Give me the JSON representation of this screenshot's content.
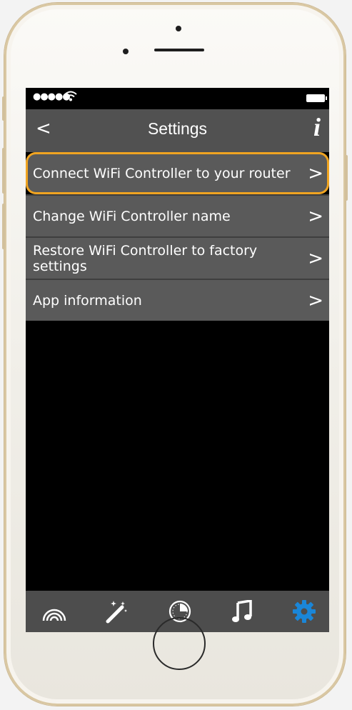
{
  "status_bar": {
    "signal": "●●●●●",
    "wifi_icon": "wifi-icon",
    "battery_icon": "battery-icon"
  },
  "header": {
    "back_icon": "<",
    "title": "Settings",
    "info_icon": "i"
  },
  "menu": {
    "items": [
      {
        "label": "Connect WiFi Controller to your router",
        "chevron": ">",
        "highlighted": true
      },
      {
        "label": "Change WiFi Controller name",
        "chevron": ">"
      },
      {
        "label": "Restore WiFi Controller to factory settings",
        "chevron": ">"
      },
      {
        "label": "App information",
        "chevron": ">"
      }
    ]
  },
  "tabbar": {
    "tabs": [
      {
        "icon": "rainbow-icon"
      },
      {
        "icon": "magic-wand-icon"
      },
      {
        "icon": "timer-icon"
      },
      {
        "icon": "music-note-icon"
      },
      {
        "icon": "gear-icon",
        "active": true
      }
    ]
  },
  "colors": {
    "highlight": "#f0a421",
    "active_tab": "#1a86d8",
    "navbar": "#515151",
    "row": "#5a5a5a"
  }
}
